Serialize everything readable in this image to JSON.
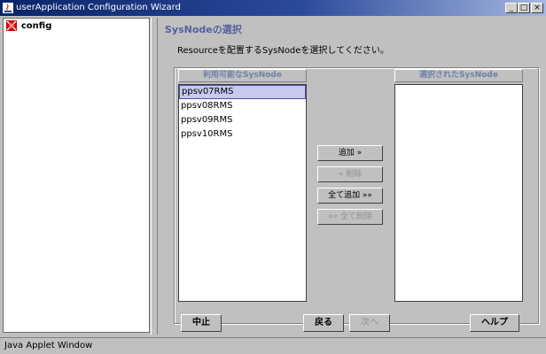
{
  "window": {
    "title": "userApplication Configuration Wizard",
    "controls": {
      "minimize": "_",
      "maximize": "□",
      "close": "×"
    }
  },
  "tree": {
    "root_label": "config",
    "root_icon": "config-icon"
  },
  "main": {
    "header": "SysNodeの選択",
    "instruction": "Resourceを配置するSysNodeを選択してください。",
    "available": {
      "label": "利用可能なSysNode",
      "items": [
        "ppsv07RMS",
        "ppsv08RMS",
        "ppsv09RMS",
        "ppsv10RMS"
      ],
      "selected_index": 0
    },
    "selected": {
      "label": "選択されたSysNode",
      "items": []
    },
    "buttons": {
      "add": "追加 »",
      "remove": "« 削除",
      "add_all": "全て追加 »»",
      "remove_all": "«« 全て削除"
    }
  },
  "footer": {
    "cancel": "中止",
    "back": "戻る",
    "next": "次へ",
    "help": "ヘルプ"
  },
  "status": {
    "text": "Java Applet Window"
  },
  "colors": {
    "title_bar": "#0a246a",
    "header_text": "#5460a0",
    "list_header_text": "#7080a8",
    "selection": "#c8c8f0"
  }
}
